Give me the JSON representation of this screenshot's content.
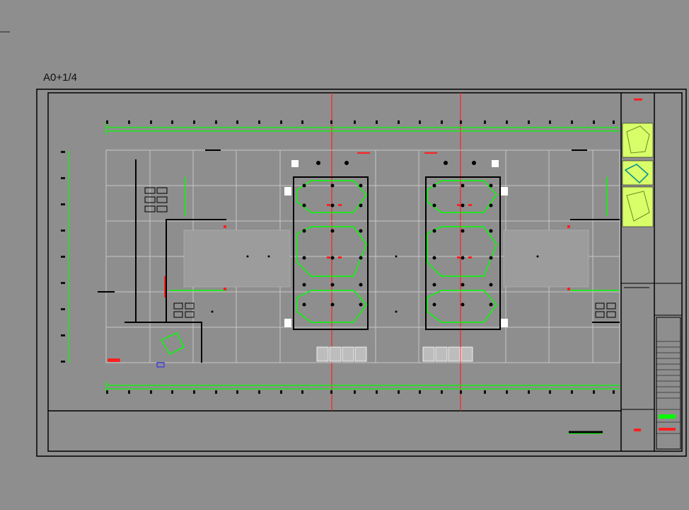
{
  "sheet": {
    "size_label": "A0+1/4"
  },
  "colors": {
    "background": "#8e8e8e",
    "frame": "#000000",
    "wiring": "#00ff00",
    "fixture": "#000000",
    "axis": "#ff2020",
    "grid": "#bdbdbd",
    "thumbnail": "#d8ff6a"
  }
}
